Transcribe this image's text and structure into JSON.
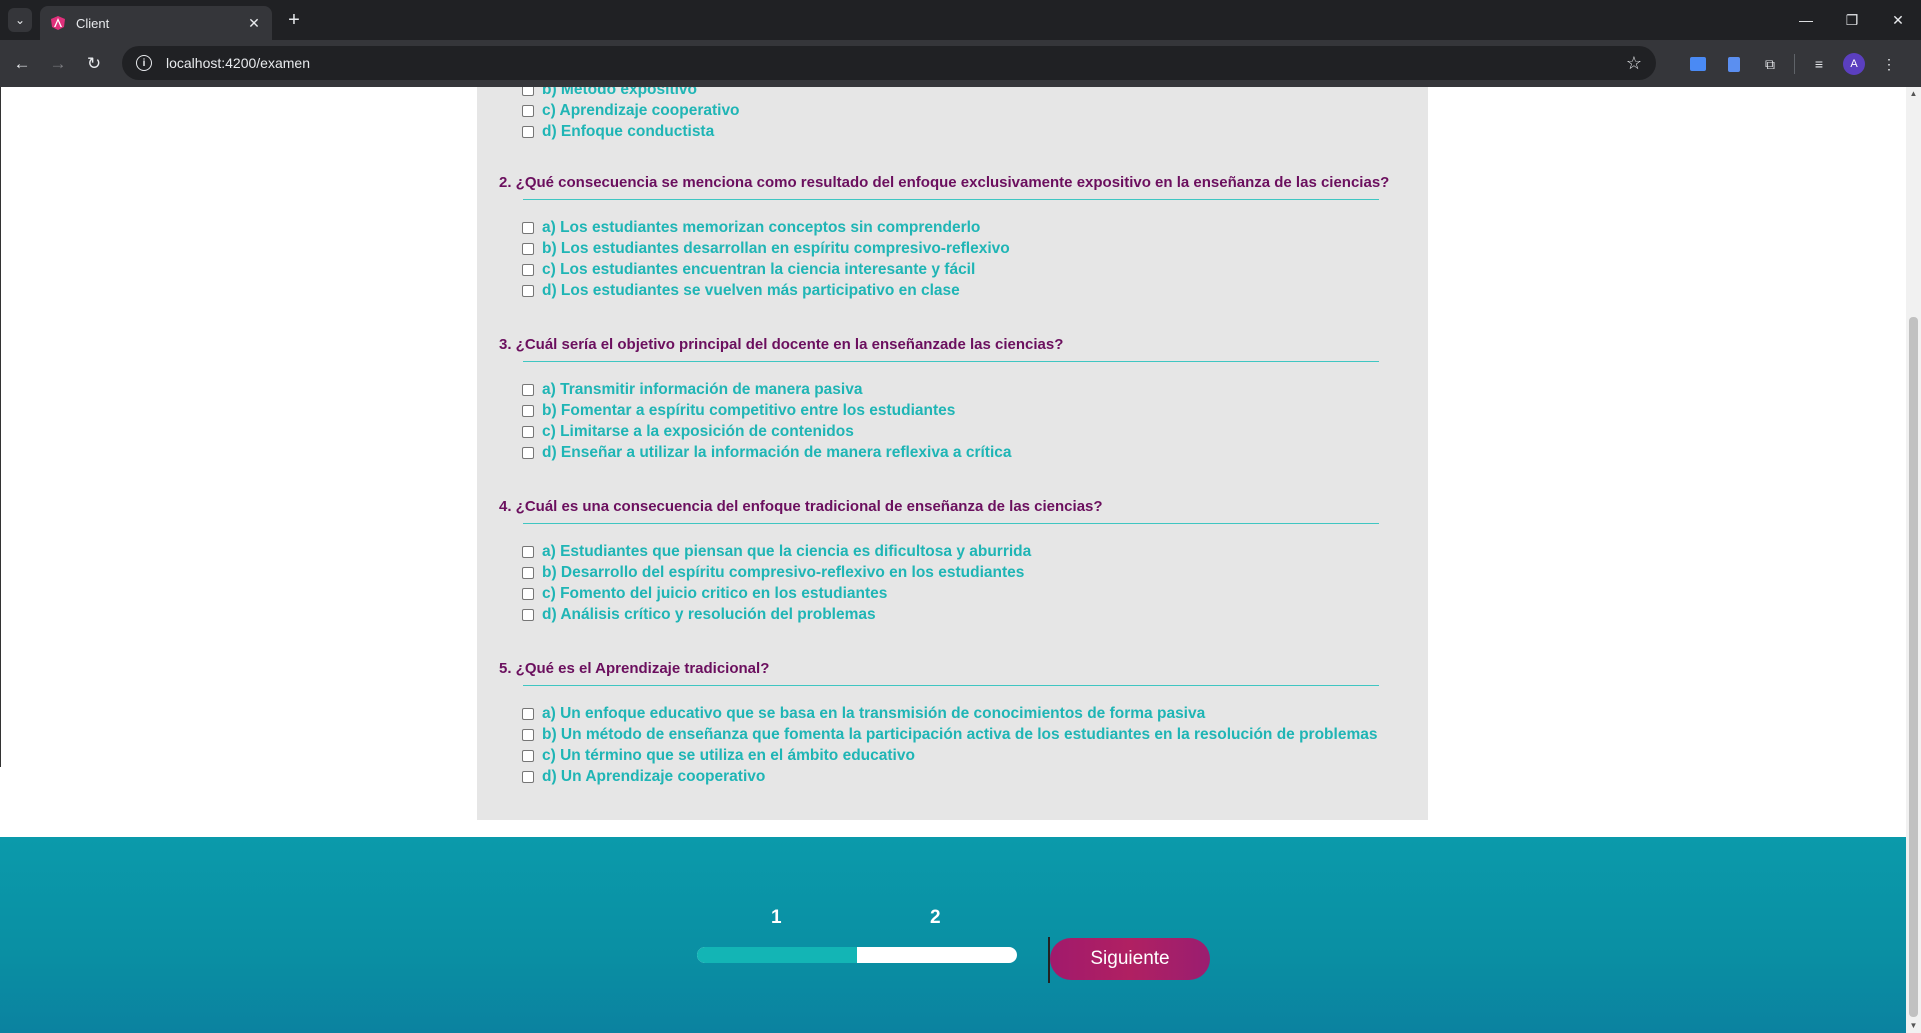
{
  "browser": {
    "tab_title": "Client",
    "url": "localhost:4200/examen",
    "avatar_letter": "A"
  },
  "quiz": {
    "partial_options": [
      "b) Método expositivo",
      "c) Aprendizaje cooperativo",
      "d) Enfoque conductista"
    ],
    "questions": [
      {
        "title": "2. ¿Qué consecuencia se menciona como resultado del enfoque exclusivamente expositivo en la enseñanza de las ciencias?",
        "options": [
          "a) Los estudiantes memorizan conceptos sin comprenderlo",
          "b) Los estudiantes desarrollan en espíritu compresivo-reflexivo",
          "c) Los estudiantes encuentran la ciencia interesante y fácil",
          "d) Los estudiantes se vuelven más participativo en clase"
        ]
      },
      {
        "title": "3. ¿Cuál sería el objetivo principal del docente en la enseñanzade las ciencias?",
        "options": [
          "a) Transmitir información de manera pasiva",
          "b) Fomentar a espíritu competitivo entre los estudiantes",
          "c) Limitarse a la exposición de contenidos",
          "d) Enseñar a utilizar la información de manera reflexiva a crítica"
        ]
      },
      {
        "title": "4. ¿Cuál es una consecuencia del enfoque tradicional de enseñanza de las ciencias?",
        "options": [
          "a) Estudiantes que piensan que la ciencia es dificultosa y aburrida",
          "b) Desarrollo del espíritu compresivo-reflexivo en los estudiantes",
          "c) Fomento del juicio critico en los estudiantes",
          "d) Análisis crítico y resolución del problemas"
        ]
      },
      {
        "title": "5. ¿Qué es el Aprendizaje tradicional?",
        "options": [
          "a) Un enfoque educativo que se basa en la transmisión de conocimientos de forma pasiva",
          "b) Un método de enseñanza que fomenta la participación activa de los estudiantes en la resolución de problemas",
          "c) Un término que se utiliza en el ámbito educativo",
          "d) Un Aprendizaje cooperativo"
        ]
      }
    ]
  },
  "footer": {
    "step_1": "1",
    "step_2": "2",
    "progress_fraction": 0.5,
    "next_label": "Siguiente"
  },
  "colors": {
    "question_title": "#6b0f5e",
    "option_text": "#1fb5b5",
    "footer_bg": "#0b9aab",
    "next_button": "#a11a6c"
  }
}
